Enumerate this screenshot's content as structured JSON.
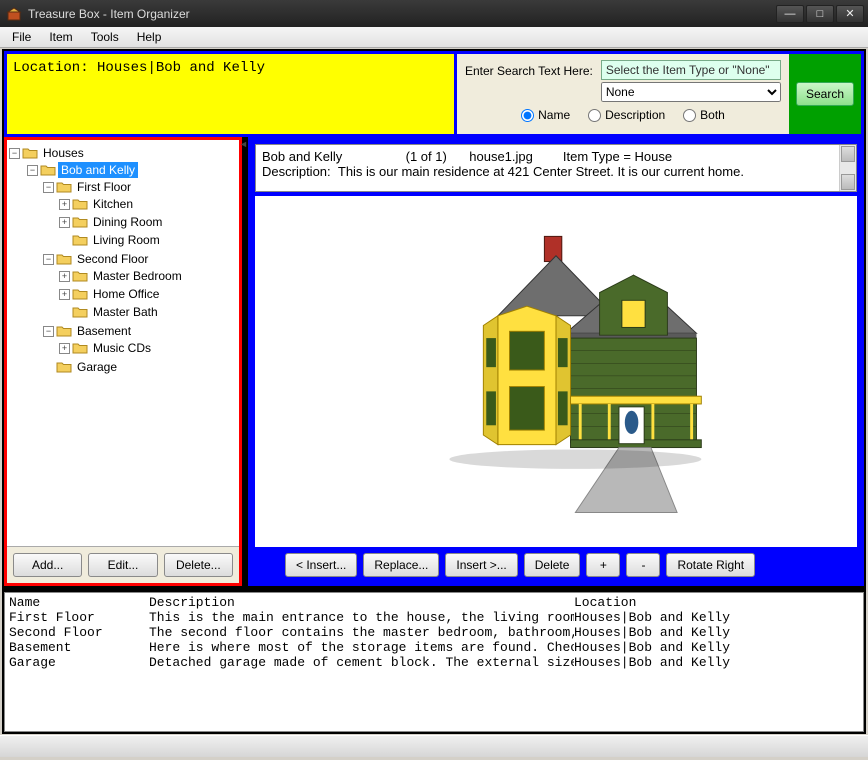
{
  "window": {
    "title": "Treasure Box - Item Organizer"
  },
  "menu": {
    "file": "File",
    "item": "Item",
    "tools": "Tools",
    "help": "Help"
  },
  "location": {
    "label": "Location:",
    "path": "Houses|Bob and Kelly"
  },
  "search": {
    "label": "Enter Search Text Here:",
    "type_hint": "Select the Item Type or \"None\"",
    "type_selected": "None",
    "radio_name": "Name",
    "radio_desc": "Description",
    "radio_both": "Both",
    "button": "Search"
  },
  "tree": {
    "root": "Houses",
    "nodes": {
      "bob_kelly": "Bob and Kelly",
      "first_floor": "First Floor",
      "kitchen": "Kitchen",
      "dining": "Dining Room",
      "living": "Living Room",
      "second_floor": "Second Floor",
      "master_bed": "Master Bedroom",
      "home_office": "Home Office",
      "master_bath": "Master Bath",
      "basement": "Basement",
      "music_cds": "Music CDs",
      "garage": "Garage"
    },
    "btn_add": "Add...",
    "btn_edit": "Edit...",
    "btn_delete": "Delete..."
  },
  "detail": {
    "name": "Bob and Kelly",
    "count": "(1 of 1)",
    "file": "house1.jpg",
    "type": "Item Type = House",
    "desc_label": "Description:",
    "desc": "This is our main residence at 421 Center Street. It is our current home."
  },
  "image_toolbar": {
    "insert_left": "< Insert...",
    "replace": "Replace...",
    "insert_right": "Insert >...",
    "delete": "Delete",
    "zoom_in": "+",
    "zoom_out": "-",
    "rotate": "Rotate Right"
  },
  "grid": {
    "headers": {
      "name": "Name",
      "desc": "Description",
      "loc": "Location"
    },
    "rows": [
      {
        "name": "First Floor",
        "desc": "This is the main entrance to the house, the living room.  I",
        "loc": "Houses|Bob and Kelly"
      },
      {
        "name": "Second Floor",
        "desc": "The second floor contains the master bedroom, bathroom, bow",
        "loc": "Houses|Bob and Kelly"
      },
      {
        "name": "Basement",
        "desc": "Here is where most of the storage items are found. Check ou",
        "loc": "Houses|Bob and Kelly"
      },
      {
        "name": "Garage",
        "desc": "Detached garage made of cement block.  The external size is",
        "loc": "Houses|Bob and Kelly"
      }
    ]
  }
}
